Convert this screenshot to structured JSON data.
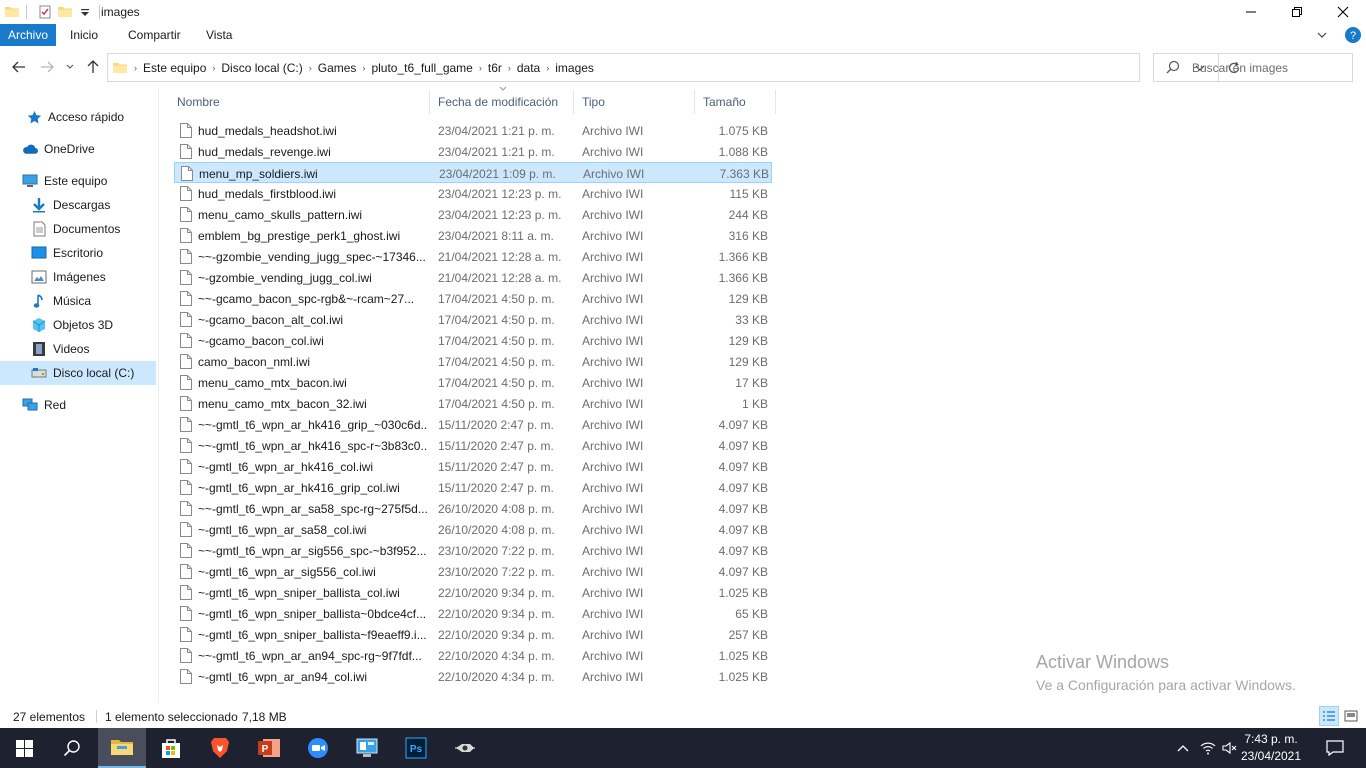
{
  "window": {
    "title": "images",
    "minimize_icon": "minimize-icon",
    "maximize_icon": "restore-icon",
    "close_icon": "close-icon"
  },
  "ribbon": {
    "tabs": [
      "Archivo",
      "Inicio",
      "Compartir",
      "Vista"
    ]
  },
  "address": {
    "crumbs": [
      "Este equipo",
      "Disco local (C:)",
      "Games",
      "pluto_t6_full_game",
      "t6r",
      "data",
      "images"
    ]
  },
  "search": {
    "placeholder": "Buscar en images"
  },
  "navpane": {
    "items": [
      {
        "label": "Acceso rápido",
        "icon": "star-icon"
      },
      {
        "label": "OneDrive",
        "icon": "cloud-icon"
      },
      {
        "label": "Este equipo",
        "icon": "computer-icon"
      },
      {
        "label": "Descargas",
        "icon": "download-icon"
      },
      {
        "label": "Documentos",
        "icon": "document-icon"
      },
      {
        "label": "Escritorio",
        "icon": "desktop-icon"
      },
      {
        "label": "Imágenes",
        "icon": "pictures-icon"
      },
      {
        "label": "Música",
        "icon": "music-icon"
      },
      {
        "label": "Objetos 3D",
        "icon": "cube-icon"
      },
      {
        "label": "Videos",
        "icon": "video-icon"
      },
      {
        "label": "Disco local (C:)",
        "icon": "drive-icon"
      },
      {
        "label": "Red",
        "icon": "network-icon"
      }
    ]
  },
  "columns": {
    "name": "Nombre",
    "date": "Fecha de modificación",
    "type": "Tipo",
    "size": "Tamaño"
  },
  "files": [
    {
      "name": "hud_medals_headshot.iwi",
      "date": "23/04/2021 1:21 p. m.",
      "type": "Archivo IWI",
      "size": "1.075 KB"
    },
    {
      "name": "hud_medals_revenge.iwi",
      "date": "23/04/2021 1:21 p. m.",
      "type": "Archivo IWI",
      "size": "1.088 KB"
    },
    {
      "name": "menu_mp_soldiers.iwi",
      "date": "23/04/2021 1:09 p. m.",
      "type": "Archivo IWI",
      "size": "7.363 KB",
      "selected": true
    },
    {
      "name": "hud_medals_firstblood.iwi",
      "date": "23/04/2021 12:23 p. m.",
      "type": "Archivo IWI",
      "size": "115 KB"
    },
    {
      "name": "menu_camo_skulls_pattern.iwi",
      "date": "23/04/2021 12:23 p. m.",
      "type": "Archivo IWI",
      "size": "244 KB"
    },
    {
      "name": "emblem_bg_prestige_perk1_ghost.iwi",
      "date": "23/04/2021 8:11 a. m.",
      "type": "Archivo IWI",
      "size": "316 KB"
    },
    {
      "name": "~~-gzombie_vending_jugg_spec-~17346...",
      "date": "21/04/2021 12:28 a. m.",
      "type": "Archivo IWI",
      "size": "1.366 KB"
    },
    {
      "name": "~-gzombie_vending_jugg_col.iwi",
      "date": "21/04/2021 12:28 a. m.",
      "type": "Archivo IWI",
      "size": "1.366 KB"
    },
    {
      "name": "~~-gcamo_bacon_spc-rgb&~-rcam~27...",
      "date": "17/04/2021 4:50 p. m.",
      "type": "Archivo IWI",
      "size": "129 KB"
    },
    {
      "name": "~-gcamo_bacon_alt_col.iwi",
      "date": "17/04/2021 4:50 p. m.",
      "type": "Archivo IWI",
      "size": "33 KB"
    },
    {
      "name": "~-gcamo_bacon_col.iwi",
      "date": "17/04/2021 4:50 p. m.",
      "type": "Archivo IWI",
      "size": "129 KB"
    },
    {
      "name": "camo_bacon_nml.iwi",
      "date": "17/04/2021 4:50 p. m.",
      "type": "Archivo IWI",
      "size": "129 KB"
    },
    {
      "name": "menu_camo_mtx_bacon.iwi",
      "date": "17/04/2021 4:50 p. m.",
      "type": "Archivo IWI",
      "size": "17 KB"
    },
    {
      "name": "menu_camo_mtx_bacon_32.iwi",
      "date": "17/04/2021 4:50 p. m.",
      "type": "Archivo IWI",
      "size": "1 KB"
    },
    {
      "name": "~~-gmtl_t6_wpn_ar_hk416_grip_~030c6d...",
      "date": "15/11/2020 2:47 p. m.",
      "type": "Archivo IWI",
      "size": "4.097 KB"
    },
    {
      "name": "~~-gmtl_t6_wpn_ar_hk416_spc-r~3b83c0...",
      "date": "15/11/2020 2:47 p. m.",
      "type": "Archivo IWI",
      "size": "4.097 KB"
    },
    {
      "name": "~-gmtl_t6_wpn_ar_hk416_col.iwi",
      "date": "15/11/2020 2:47 p. m.",
      "type": "Archivo IWI",
      "size": "4.097 KB"
    },
    {
      "name": "~-gmtl_t6_wpn_ar_hk416_grip_col.iwi",
      "date": "15/11/2020 2:47 p. m.",
      "type": "Archivo IWI",
      "size": "4.097 KB"
    },
    {
      "name": "~~-gmtl_t6_wpn_ar_sa58_spc-rg~275f5d...",
      "date": "26/10/2020 4:08 p. m.",
      "type": "Archivo IWI",
      "size": "4.097 KB"
    },
    {
      "name": "~-gmtl_t6_wpn_ar_sa58_col.iwi",
      "date": "26/10/2020 4:08 p. m.",
      "type": "Archivo IWI",
      "size": "4.097 KB"
    },
    {
      "name": "~~-gmtl_t6_wpn_ar_sig556_spc-~b3f952...",
      "date": "23/10/2020 7:22 p. m.",
      "type": "Archivo IWI",
      "size": "4.097 KB"
    },
    {
      "name": "~-gmtl_t6_wpn_ar_sig556_col.iwi",
      "date": "23/10/2020 7:22 p. m.",
      "type": "Archivo IWI",
      "size": "4.097 KB"
    },
    {
      "name": "~-gmtl_t6_wpn_sniper_ballista_col.iwi",
      "date": "22/10/2020 9:34 p. m.",
      "type": "Archivo IWI",
      "size": "1.025 KB"
    },
    {
      "name": "~-gmtl_t6_wpn_sniper_ballista~0bdce4cf...",
      "date": "22/10/2020 9:34 p. m.",
      "type": "Archivo IWI",
      "size": "65 KB"
    },
    {
      "name": "~-gmtl_t6_wpn_sniper_ballista~f9eaeff9.i...",
      "date": "22/10/2020 9:34 p. m.",
      "type": "Archivo IWI",
      "size": "257 KB"
    },
    {
      "name": "~~-gmtl_t6_wpn_ar_an94_spc-rg~9f7fdf...",
      "date": "22/10/2020 4:34 p. m.",
      "type": "Archivo IWI",
      "size": "1.025 KB"
    },
    {
      "name": "~-gmtl_t6_wpn_ar_an94_col.iwi",
      "date": "22/10/2020 4:34 p. m.",
      "type": "Archivo IWI",
      "size": "1.025 KB"
    }
  ],
  "status": {
    "count": "27 elementos",
    "selection": "1 elemento seleccionado",
    "selection_size": "7,18 MB"
  },
  "watermark": {
    "line1": "Activar Windows",
    "line2": "Ve a Configuración para activar Windows."
  },
  "taskbar": {
    "apps": [
      "start-icon",
      "search-icon",
      "file-explorer-icon",
      "store-icon",
      "brave-icon",
      "powerpoint-icon",
      "zoom-icon",
      "control-panel-icon",
      "photoshop-icon",
      "game-icon"
    ],
    "time": "7:43 p. m.",
    "date": "23/04/2021"
  },
  "colors": {
    "accent": "#1979ca",
    "selection": "#cce8ff",
    "taskbar": "#1e2130"
  }
}
